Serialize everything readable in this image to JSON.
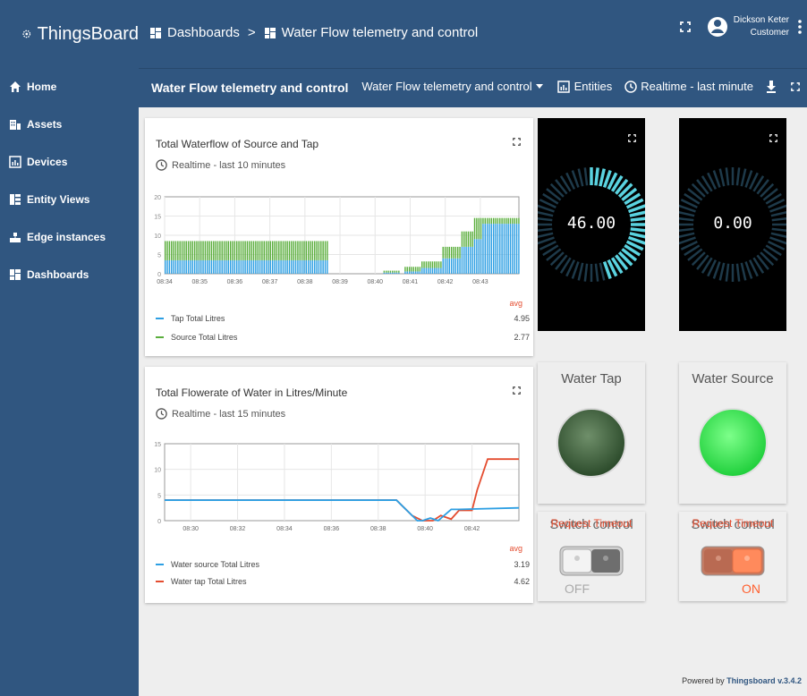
{
  "app": {
    "name": "ThingsBoard"
  },
  "sidebar": {
    "items": [
      {
        "label": "Home",
        "icon": "home-icon"
      },
      {
        "label": "Assets",
        "icon": "assets-icon"
      },
      {
        "label": "Devices",
        "icon": "devices-icon"
      },
      {
        "label": "Entity Views",
        "icon": "entity-views-icon"
      },
      {
        "label": "Edge instances",
        "icon": "edge-icon"
      },
      {
        "label": "Dashboards",
        "icon": "dashboards-icon"
      }
    ]
  },
  "header": {
    "breadcrumb": [
      "Dashboards",
      "Water Flow telemetry and control"
    ],
    "breadcrumb_sep": ">",
    "user": {
      "name": "Dickson Keter",
      "role": "Customer"
    }
  },
  "subbar": {
    "title": "Water Flow telemetry and control",
    "state_select": "Water Flow telemetry and control",
    "entities_label": "Entities",
    "timewindow": "Realtime - last minute"
  },
  "colors": {
    "header": "#305680",
    "blue_series": "#2d9fe3",
    "green_series": "#5aae3c",
    "red_series": "#e44c2f",
    "gauge_cyan": "#5ad3e0"
  },
  "widgets": {
    "waterflow": {
      "title": "Total Waterflow of Source and Tap",
      "timewindow": "Realtime - last 10 minutes",
      "avg_label": "avg",
      "legend": [
        {
          "name": "Tap Total Litres",
          "avg": "4.95"
        },
        {
          "name": "Source Total Litres",
          "avg": "2.77"
        }
      ],
      "chart_data": {
        "type": "bar",
        "ylim": [
          0,
          20
        ],
        "yticks": [
          "0",
          "5",
          "10",
          "15",
          "20"
        ],
        "xticks": [
          "08:34",
          "08:35",
          "08:36",
          "08:37",
          "08:38",
          "08:39",
          "08:40",
          "08:41",
          "08:42",
          "08:43"
        ],
        "series": [
          {
            "name": "Tap Total Litres",
            "segments": [
              {
                "from": 0.0,
                "to": 4.65,
                "value": 3.5
              },
              {
                "from": 6.2,
                "to": 6.7,
                "value": 0.3
              },
              {
                "from": 6.8,
                "to": 7.3,
                "value": 0.6
              },
              {
                "from": 7.3,
                "to": 7.9,
                "value": 1.5
              },
              {
                "from": 7.9,
                "to": 8.4,
                "value": 4
              },
              {
                "from": 8.4,
                "to": 8.8,
                "value": 7
              },
              {
                "from": 8.8,
                "to": 9.0,
                "value": 9
              },
              {
                "from": 9.0,
                "to": 10.1,
                "value": 13
              }
            ]
          },
          {
            "name": "Source Total Litres",
            "segments": [
              {
                "from": 0.0,
                "to": 4.65,
                "value": 8.5
              },
              {
                "from": 6.2,
                "to": 6.7,
                "value": 0.8
              },
              {
                "from": 6.8,
                "to": 7.3,
                "value": 1.8
              },
              {
                "from": 7.3,
                "to": 7.9,
                "value": 3.2
              },
              {
                "from": 7.9,
                "to": 8.4,
                "value": 7
              },
              {
                "from": 8.4,
                "to": 8.8,
                "value": 11
              },
              {
                "from": 8.8,
                "to": 10.1,
                "value": 14.5
              }
            ]
          }
        ]
      }
    },
    "flowrate": {
      "title": "Total Flowerate of Water in Litres/Minute",
      "timewindow": "Realtime - last 15 minutes",
      "avg_label": "avg",
      "legend": [
        {
          "name": "Water source Total Litres",
          "avg": "3.19"
        },
        {
          "name": "Water tap Total Litres",
          "avg": "4.62"
        }
      ],
      "chart_data": {
        "type": "line",
        "ylim": [
          0,
          15
        ],
        "yticks": [
          "0",
          "5",
          "10",
          "15"
        ],
        "xticks": [
          "08:30",
          "08:32",
          "08:34",
          "08:36",
          "08:38",
          "08:40",
          "08:42"
        ],
        "series": [
          {
            "name": "Water source Total Litres",
            "x": [
              0,
              8.9,
              9.1,
              9.5,
              9.7,
              9.9,
              10.2,
              10.5,
              11.0,
              11.3,
              13.6
            ],
            "y": [
              4,
              4,
              3,
              1,
              0,
              0,
              0.5,
              0,
              2.2,
              2.2,
              2.5
            ]
          },
          {
            "name": "Water tap Total Litres",
            "x": [
              0,
              8.9,
              9.1,
              9.5,
              9.9,
              10.3,
              10.6,
              11.0,
              11.3,
              11.8,
              12.0,
              12.4,
              13.6
            ],
            "y": [
              4,
              4,
              3,
              1,
              0,
              0,
              1,
              0.3,
              2,
              2,
              6,
              12,
              12
            ]
          }
        ]
      }
    },
    "gauge1": {
      "value": "46.00",
      "fill": 0.46
    },
    "gauge2": {
      "value": "0.00",
      "fill": 0
    },
    "tap_led": {
      "title": "Water Tap",
      "state": "off"
    },
    "source_led": {
      "title": "Water Source",
      "state": "on"
    },
    "tap_switch": {
      "title": "Switch control",
      "error": "Request Timeout",
      "state": "OFF"
    },
    "source_switch": {
      "title": "Switch control",
      "error": "Request Timeout",
      "state": "ON"
    }
  },
  "footer": {
    "powered_prefix": "Powered by",
    "powered_link": "Thingsboard v.3.4.2"
  }
}
